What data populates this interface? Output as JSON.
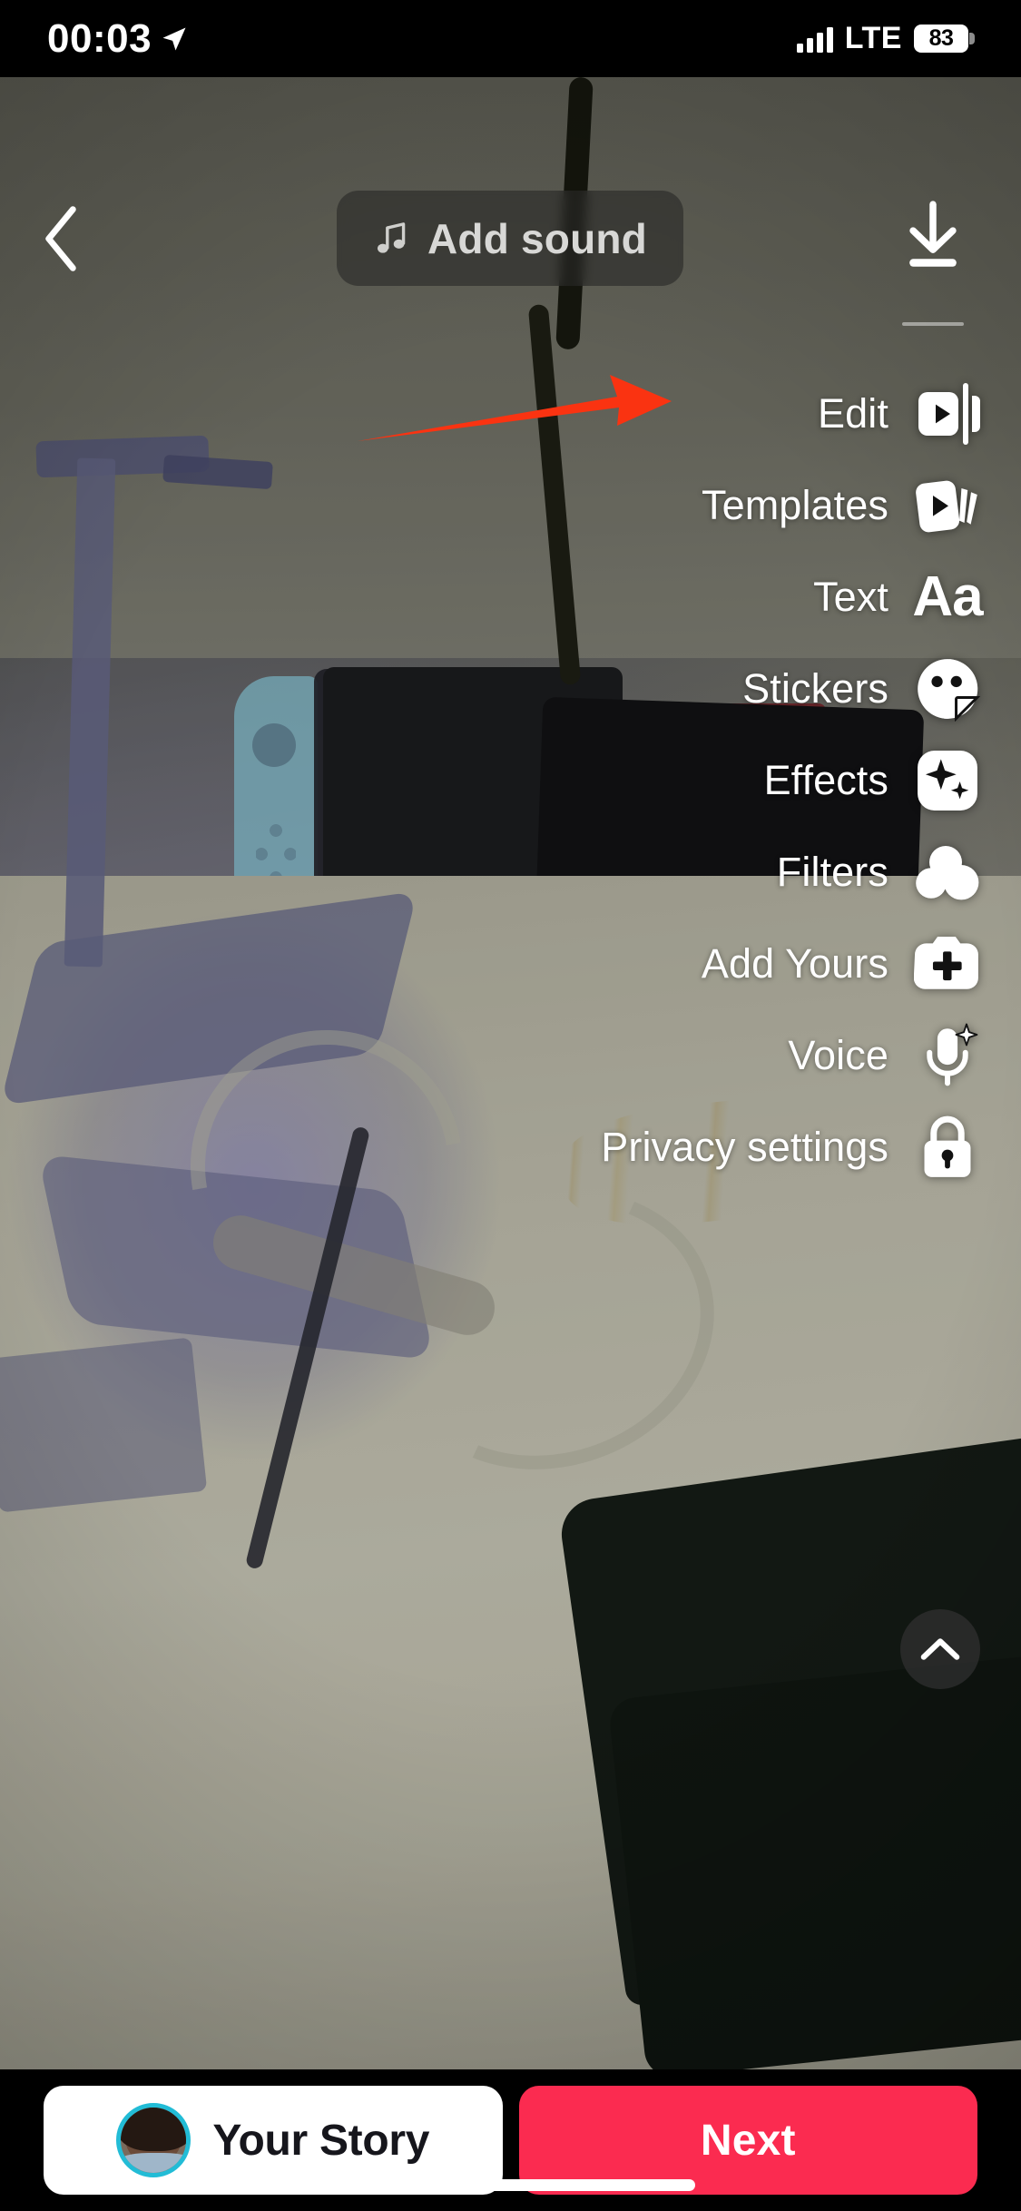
{
  "status_bar": {
    "time": "00:03",
    "location_icon": "location-arrow-icon",
    "signal_icon": "cellular-bars-icon",
    "network": "LTE",
    "battery_percent": "83",
    "battery_icon": "battery-icon"
  },
  "top_bar": {
    "back_icon": "chevron-left-icon",
    "add_sound_label": "Add sound",
    "add_sound_icon": "music-note-icon",
    "download_icon": "download-icon"
  },
  "tools": [
    {
      "label": "Edit",
      "icon": "clip-trim-icon"
    },
    {
      "label": "Templates",
      "icon": "template-cards-icon"
    },
    {
      "label": "Text",
      "icon": "text-aa-icon"
    },
    {
      "label": "Stickers",
      "icon": "sticker-smiley-icon"
    },
    {
      "label": "Effects",
      "icon": "sparkles-effects-icon"
    },
    {
      "label": "Filters",
      "icon": "filters-circles-icon"
    },
    {
      "label": "Add Yours",
      "icon": "camera-plus-icon"
    },
    {
      "label": "Voice",
      "icon": "microphone-sparkle-icon"
    },
    {
      "label": "Privacy settings",
      "icon": "lock-icon"
    }
  ],
  "collapse": {
    "icon": "chevron-up-icon"
  },
  "annotation": {
    "type": "arrow",
    "points_to": "Edit",
    "color": "#FA3311"
  },
  "bottom_bar": {
    "story_label": "Your Story",
    "avatar_icon": "user-avatar",
    "avatar_ring_color": "#22BCD6",
    "next_label": "Next",
    "next_color": "#FB2B50"
  },
  "colors": {
    "accent_red": "#FB2B50",
    "annotation_red": "#FA3311",
    "avatar_ring": "#22BCD6",
    "chrome_black": "#000000",
    "pill_white": "#FFFFFF"
  },
  "icon_glyphs": {
    "text_aa": "Aa"
  }
}
